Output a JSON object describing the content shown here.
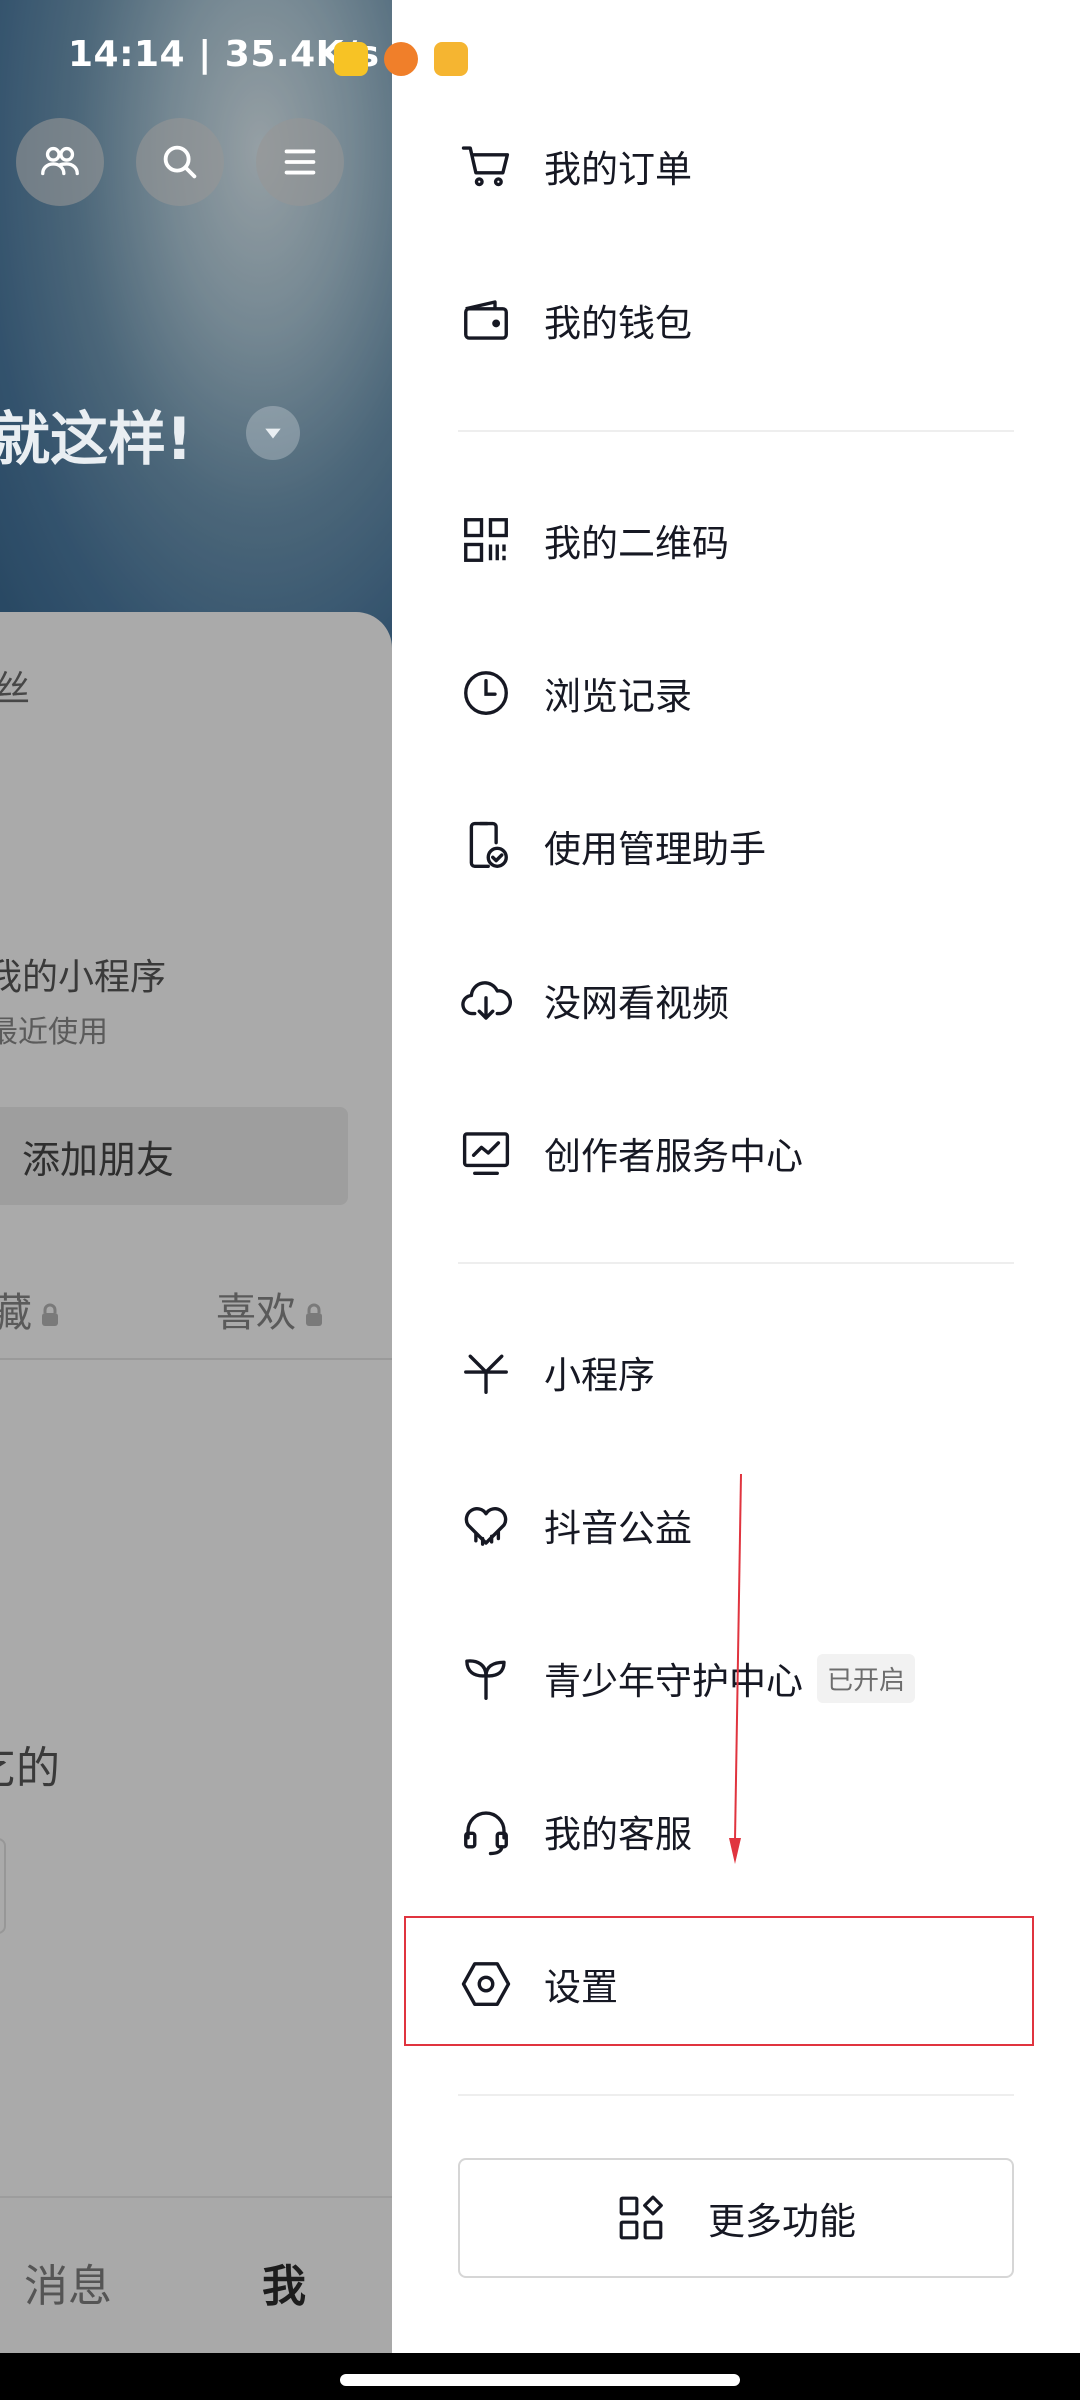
{
  "status_bar": {
    "time_speed": "14:14 | 35.4K/s"
  },
  "profile": {
    "name": "就这样!",
    "fans_label": "丝",
    "mini_program_title": "我的小程序",
    "mini_program_sub": "最近使用",
    "add_friend_label": "添加朋友",
    "tab_favorites": "藏",
    "tab_likes": "喜欢",
    "partial_text": "乞的"
  },
  "bottom_nav": {
    "messages": "消息",
    "me": "我"
  },
  "drawer": {
    "menu_group_1": [
      {
        "label": "我的订单",
        "icon": "cart-icon"
      },
      {
        "label": "我的钱包",
        "icon": "wallet-icon"
      }
    ],
    "menu_group_2": [
      {
        "label": "我的二维码",
        "icon": "qrcode-icon"
      },
      {
        "label": "浏览记录",
        "icon": "clock-icon"
      },
      {
        "label": "使用管理助手",
        "icon": "phone-check-icon"
      },
      {
        "label": "没网看视频",
        "icon": "cloud-download-icon"
      },
      {
        "label": "创作者服务中心",
        "icon": "monitor-chart-icon"
      }
    ],
    "menu_group_3": [
      {
        "label": "小程序",
        "icon": "asterisk-icon"
      },
      {
        "label": "抖音公益",
        "icon": "heart-rain-icon"
      },
      {
        "label": "青少年守护中心",
        "icon": "sprout-icon",
        "badge": "已开启"
      },
      {
        "label": "我的客服",
        "icon": "headset-icon"
      },
      {
        "label": "设置",
        "icon": "hexagon-gear-icon"
      }
    ],
    "more_button_label": "更多功能"
  },
  "colors": {
    "annotation_red": "#e0343f",
    "text_primary": "#161823"
  }
}
